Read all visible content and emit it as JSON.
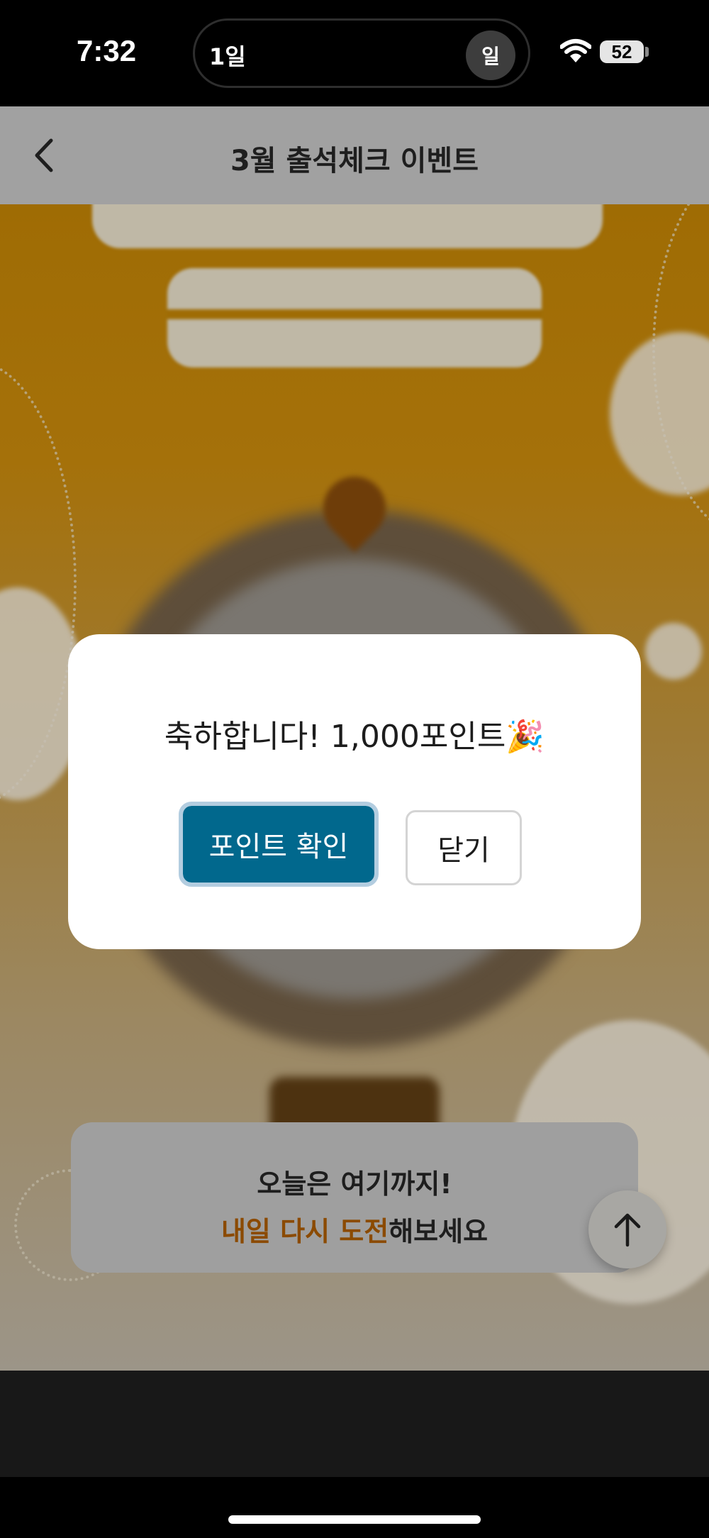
{
  "status_bar": {
    "time": "7:32",
    "island_label": "1일",
    "island_badge": "일",
    "battery": "52"
  },
  "nav": {
    "title": "3월 출석체크 이벤트",
    "back_icon": "chevron-left-icon"
  },
  "modal": {
    "message": "축하합니다! 1,000포인트🎉",
    "confirm_label": "포인트 확인",
    "close_label": "닫기"
  },
  "bottom_card": {
    "line1": "오늘은 여기까지!",
    "line2_accent": "내일 다시 도전",
    "line2_rest": "해보세요"
  },
  "scroll_top_icon": "arrow-up-icon",
  "colors": {
    "confirm_button": "#01688d",
    "accent_text": "#8b4a00",
    "background": "#9f6c04"
  }
}
